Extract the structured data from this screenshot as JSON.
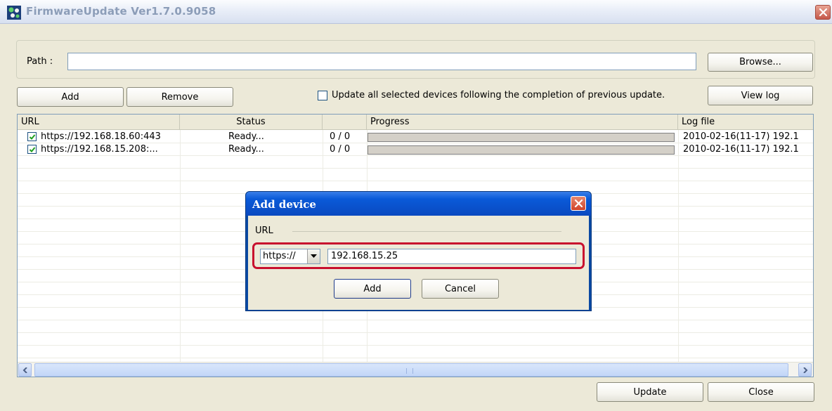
{
  "window": {
    "title": "FirmwareUpdate Ver1.7.0.9058"
  },
  "path": {
    "label": "Path :",
    "value": "",
    "browse_label": "Browse..."
  },
  "toolbar": {
    "add_label": "Add",
    "remove_label": "Remove",
    "sequential_checkbox_label": "Update all selected devices following the completion of previous update.",
    "sequential_checked": false,
    "view_log_label": "View log"
  },
  "list": {
    "columns": [
      "URL",
      "Status",
      "",
      "Progress",
      "Log file"
    ],
    "rows": [
      {
        "checked": true,
        "url": "https://192.168.18.60:443",
        "status": "Ready...",
        "count": "0 / 0",
        "progress": 0,
        "log": "2010-02-16(11-17) 192.1"
      },
      {
        "checked": true,
        "url": "https://192.168.15.208:...",
        "status": "Ready...",
        "count": "0 / 0",
        "progress": 0,
        "log": "2010-02-16(11-17) 192.1"
      }
    ]
  },
  "footer": {
    "update_label": "Update",
    "close_label": "Close"
  },
  "dialog": {
    "title": "Add device",
    "url_group_label": "URL",
    "protocol_selected": "https://",
    "address_value": "192.168.15.25",
    "add_label": "Add",
    "cancel_label": "Cancel"
  },
  "colors": {
    "dialog_title": "#0a49c0",
    "highlight": "#c8102e",
    "window_bg": "#ece9d8"
  }
}
